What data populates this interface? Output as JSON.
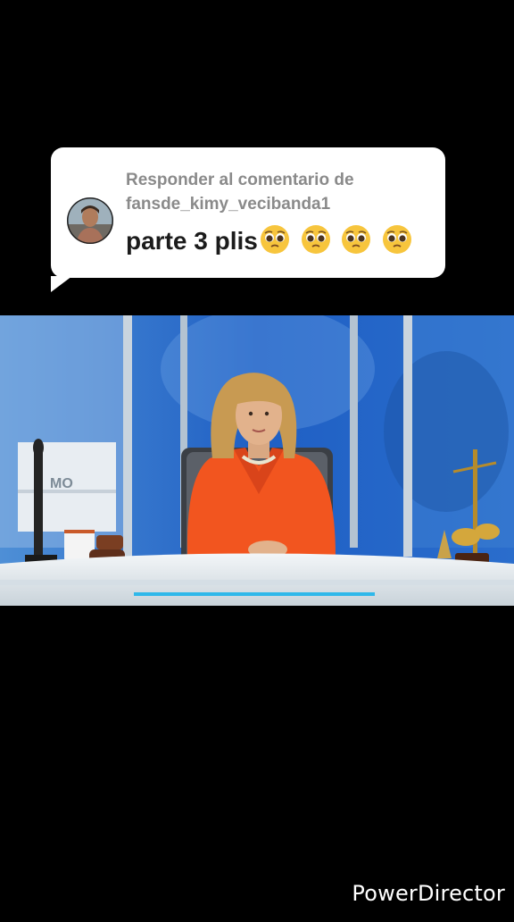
{
  "reply": {
    "line1": "Responder al comentario de",
    "line2": "fansde_kimy_vecibanda1",
    "comment": "parte 3 plis",
    "emoji_icons": [
      "pleading-face",
      "pleading-face",
      "pleading-face",
      "pleading-face"
    ]
  },
  "video": {
    "set_sign": "MO",
    "colors": {
      "studio_blue": "#1b63c8",
      "jacket": "#f2551f",
      "desk": "#e9eef2"
    }
  },
  "watermark": "PowerDirector"
}
